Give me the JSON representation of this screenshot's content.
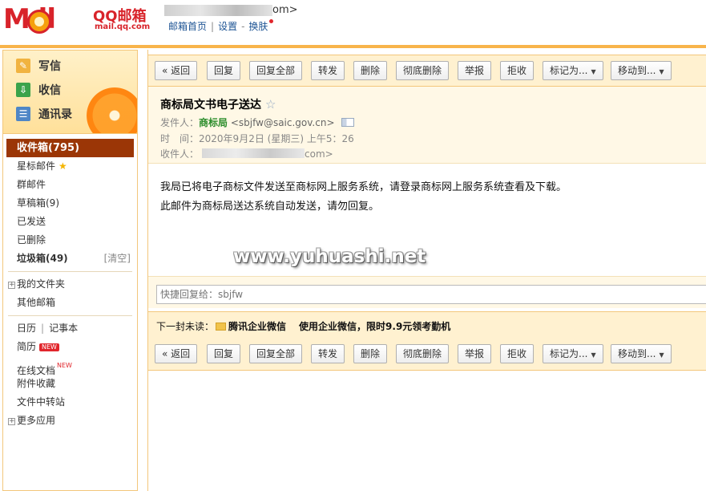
{
  "header": {
    "logo_mail": "M  il",
    "logo_qq": "QQ邮箱",
    "logo_domain": "mail.qq.com",
    "user_suffix": "om>",
    "links": [
      "邮箱首页",
      "设置",
      "换肤"
    ]
  },
  "quick_actions": [
    {
      "label": "写信",
      "icon": "✎"
    },
    {
      "label": "收信",
      "icon": "⇩"
    },
    {
      "label": "通讯录",
      "icon": "☰"
    }
  ],
  "folders": {
    "inbox": "收件箱(795)",
    "starred": "星标邮件",
    "group": "群邮件",
    "drafts": "草稿箱(9)",
    "sent": "已发送",
    "deleted": "已删除",
    "spam": "垃圾箱(49)",
    "spam_clear": "[清空]",
    "my_folders": "我的文件夹",
    "other_mailbox": "其他邮箱",
    "calendar": "日历",
    "notes": "记事本",
    "resume": "简历",
    "docs": "在线文档",
    "attachments": "附件收藏",
    "transfer": "文件中转站",
    "more_apps": "更多应用",
    "new_badge": "NEW"
  },
  "toolbar": {
    "back": "« 返回",
    "reply": "回复",
    "reply_all": "回复全部",
    "forward": "转发",
    "delete": "删除",
    "delete_perm": "彻底删除",
    "report": "举报",
    "reject": "拒收",
    "mark_as": "标记为...",
    "move_to": "移动到..."
  },
  "message": {
    "subject": "商标局文书电子送达",
    "from_label": "发件人：",
    "sender_name": "商标局",
    "sender_addr": "<sbjfw@saic.gov.cn>",
    "time_label": "时　间：",
    "time_value": "2020年9月2日 (星期三) 上午5：26",
    "to_label": "收件人：",
    "to_suffix": "com>",
    "body_line1": "我局已将电子商标文件发送至商标网上服务系统，请登录商标网上服务系统查看及下载。",
    "body_line2": "此邮件为商标局送达系统自动发送，请勿回复。"
  },
  "watermark": "www.yuhuashi.net",
  "reply": {
    "placeholder": "快捷回复给：sbjfw"
  },
  "next_unread": {
    "label": "下一封未读：",
    "sender": "腾讯企业微信",
    "subject": "使用企业微信，限时9.9元领考勤机"
  }
}
